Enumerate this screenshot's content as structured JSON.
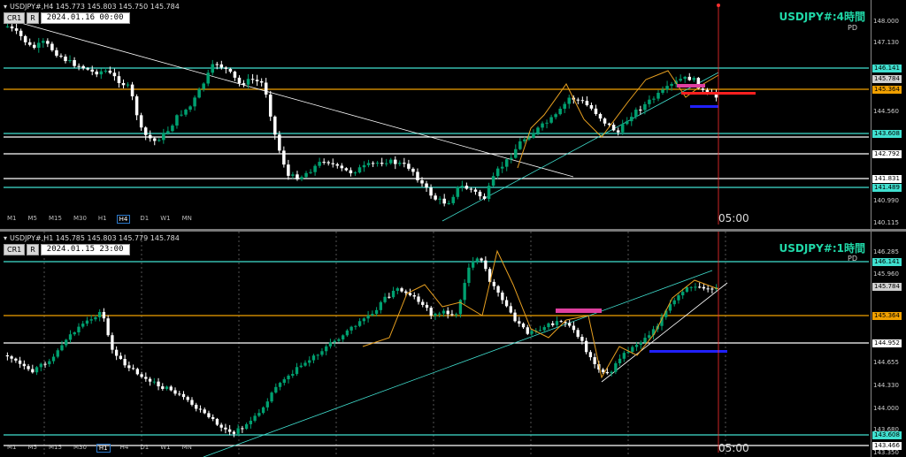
{
  "top": {
    "header": "USDJPY#,H4  145.773 145.803 145.750 145.784",
    "btn1": "CR1",
    "btn2": "R",
    "date": "2024.01.16 00:00",
    "title": "USDJPY#:4時間",
    "subtitle": "PD",
    "timeframes": [
      "M1",
      "M5",
      "M15",
      "M30",
      "H1",
      "H4",
      "D1",
      "W1",
      "MN"
    ],
    "active_tf": "H4",
    "time_label": "05:00",
    "axis": [
      "148.000",
      "147.130",
      "146.141",
      "145.784",
      "145.364",
      "144.560",
      "143.608",
      "142.792",
      "141.831",
      "141.489",
      "140.990",
      "140.115"
    ],
    "tags": [
      {
        "text": "146.141",
        "bg": "#40e0d0",
        "fg": "#000"
      },
      {
        "text": "145.784",
        "bg": "#d0d0d0",
        "fg": "#000"
      },
      {
        "text": "145.364",
        "bg": "#f0a000",
        "fg": "#000"
      },
      {
        "text": "143.608",
        "bg": "#40e0d0",
        "fg": "#000"
      },
      {
        "text": "142.792",
        "bg": "#ffffff",
        "fg": "#000"
      },
      {
        "text": "141.831",
        "bg": "#ffffff",
        "fg": "#000"
      },
      {
        "text": "141.489",
        "bg": "#40e0d0",
        "fg": "#000"
      }
    ]
  },
  "bottom": {
    "header": "USDJPY#,H1  145.785 145.803 145.779 145.784",
    "btn1": "CR1",
    "btn2": "R",
    "date": "2024.01.15 23:00",
    "title": "USDJPY#:1時間",
    "subtitle": "PD",
    "timeframes": [
      "M1",
      "M5",
      "M15",
      "M30",
      "H1",
      "H4",
      "D1",
      "W1",
      "MN"
    ],
    "active_tf": "H1",
    "time_label": "05:00",
    "axis": [
      "146.285",
      "145.960",
      "145.784",
      "145.364",
      "144.952",
      "144.655",
      "144.330",
      "144.000",
      "143.680",
      "143.350"
    ],
    "tags": [
      {
        "text": "146.141",
        "bg": "#40e0d0",
        "fg": "#000"
      },
      {
        "text": "145.784",
        "bg": "#d0d0d0",
        "fg": "#000"
      },
      {
        "text": "145.364",
        "bg": "#f0a000",
        "fg": "#000"
      },
      {
        "text": "144.952",
        "bg": "#ffffff",
        "fg": "#000"
      },
      {
        "text": "143.608",
        "bg": "#40e0d0",
        "fg": "#000"
      },
      {
        "text": "143.466",
        "bg": "#ffffff",
        "fg": "#000"
      }
    ]
  },
  "colors": {
    "bull": "#00a070",
    "bear": "#ffffff",
    "zigzag": "#e8a020",
    "cyan": "#40e0d0",
    "orange": "#f0a000",
    "magenta": "#e040a0",
    "red": "#ff2020",
    "blue": "#2020ff",
    "vline": "#ff3030"
  }
}
